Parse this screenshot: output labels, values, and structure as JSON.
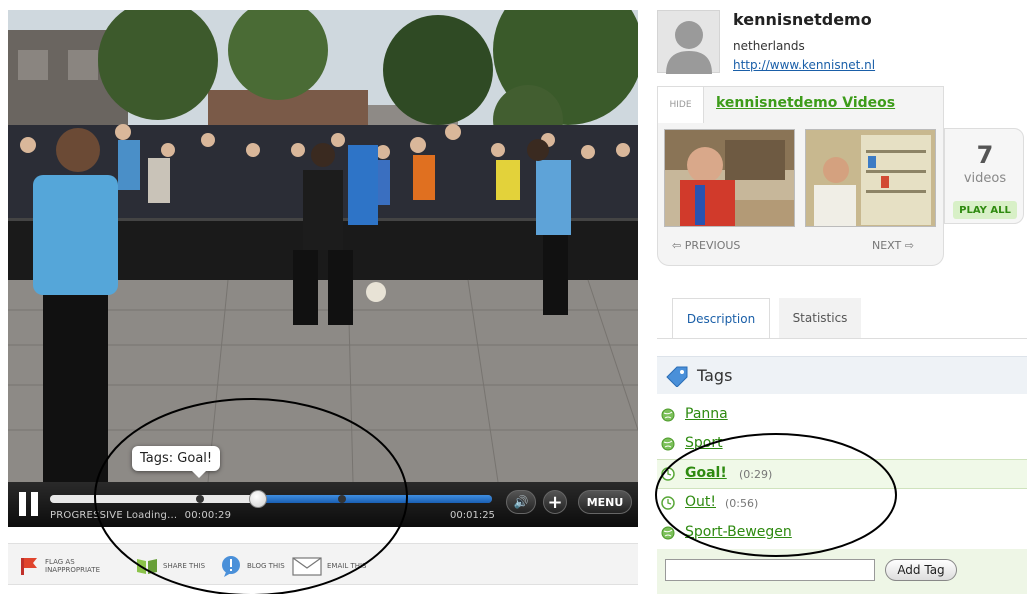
{
  "player": {
    "tooltip": "Tags: Goal!",
    "status": "PROGRESSIVE Loading...",
    "current_time": "00:00:29",
    "duration": "00:01:25",
    "menu_label": "MENU",
    "progress_fraction": 0.34,
    "buffered_fraction": 0.47,
    "tag_marker_fractions": [
      0.34,
      0.66
    ]
  },
  "actions": {
    "flag": "FLAG AS INAPPROPRIATE",
    "share": "SHARE THIS",
    "blog": "BLOG THIS",
    "email": "EMAIL THIS"
  },
  "user": {
    "name": "kennisnetdemo",
    "country": "netherlands",
    "url": "http://www.kennisnet.nl"
  },
  "videos": {
    "hide": "HIDE",
    "title": "kennisnetdemo Videos",
    "previous": "PREVIOUS",
    "next": "NEXT",
    "count": "7",
    "count_label": "videos",
    "play_all": "PLAY ALL"
  },
  "tabs": {
    "description": "Description",
    "statistics": "Statistics"
  },
  "tags": {
    "title": "Tags",
    "items": [
      {
        "label": "Panna",
        "time": ""
      },
      {
        "label": "Sport",
        "time": ""
      },
      {
        "label": "Goal!",
        "time": "(0:29)"
      },
      {
        "label": "Out!",
        "time": "(0:56)"
      },
      {
        "label": "Sport-Bewegen",
        "time": ""
      }
    ],
    "add_button": "Add Tag"
  },
  "colors": {
    "accent_green": "#3d9c1a",
    "link_blue": "#1a5fa8",
    "progress_blue": "#2f7fd3"
  }
}
